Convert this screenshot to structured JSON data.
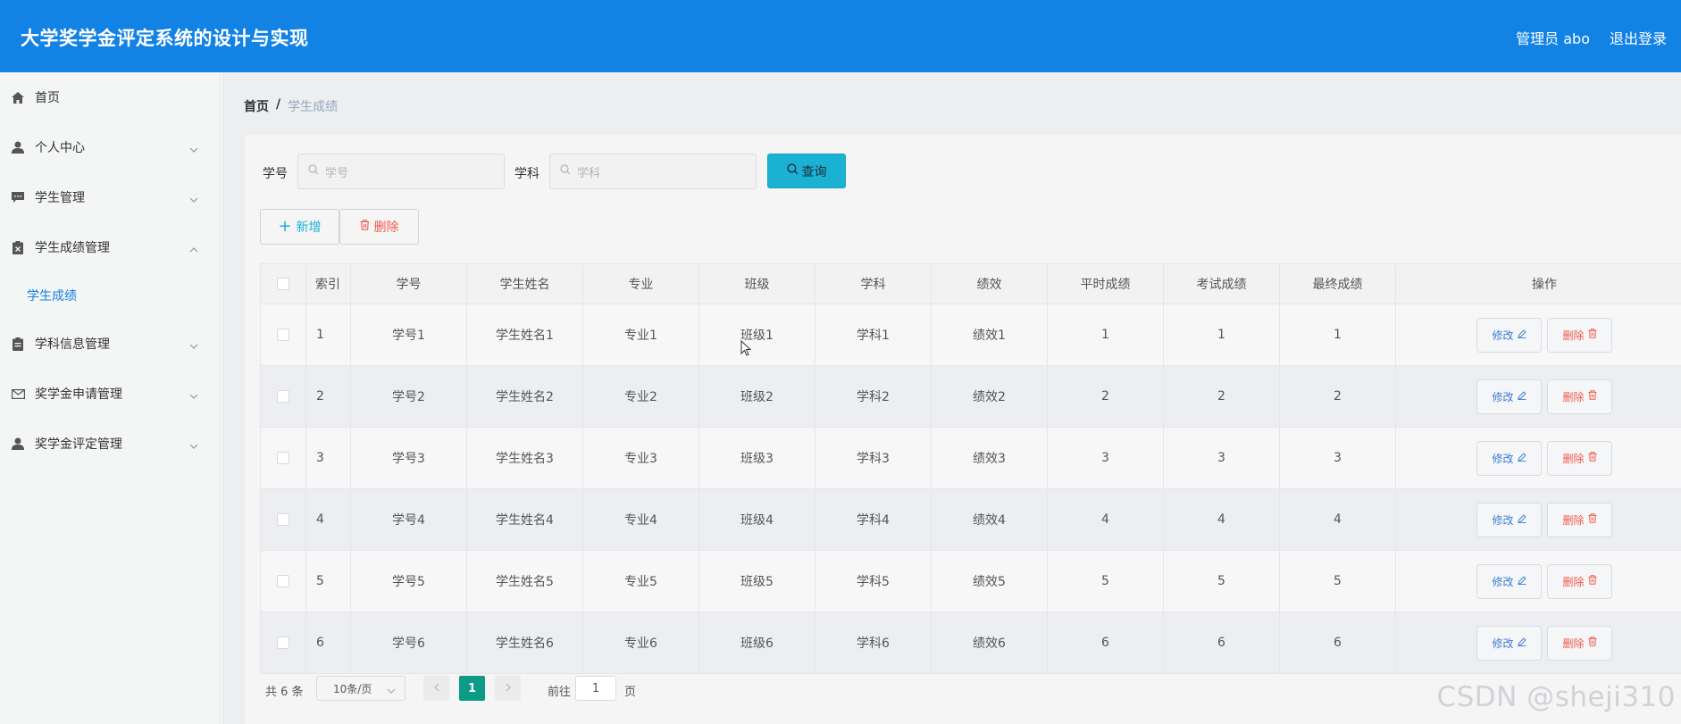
{
  "header": {
    "title": "大学奖学金评定系统的设计与实现",
    "user": "管理员 abo",
    "logout": "退出登录",
    "bg_color": "#1282e4"
  },
  "sidebar": {
    "items": [
      {
        "label": "首页",
        "icon": "home-icon"
      },
      {
        "label": "个人中心",
        "icon": "user-icon",
        "expandable": true
      },
      {
        "label": "学生管理",
        "icon": "message-icon",
        "expandable": true
      },
      {
        "label": "学生成绩管理",
        "icon": "clipboard-x-icon",
        "expanded": true
      },
      {
        "label": "学科信息管理",
        "icon": "clipboard-icon",
        "expandable": true
      },
      {
        "label": "奖学金申请管理",
        "icon": "mail-icon",
        "expandable": true
      },
      {
        "label": "奖学金评定管理",
        "icon": "user-icon",
        "expandable": true
      }
    ],
    "sub_item": "学生成绩"
  },
  "breadcrumb": {
    "home": "首页",
    "separator": "/",
    "current": "学生成绩"
  },
  "search": {
    "id_label": "学号",
    "id_placeholder": "学号",
    "subject_label": "学科",
    "subject_placeholder": "学科",
    "query_button": "查询"
  },
  "toolbar": {
    "add": "新增",
    "delete": "删除"
  },
  "table": {
    "headers": [
      "索引",
      "学号",
      "学生姓名",
      "专业",
      "班级",
      "学科",
      "绩效",
      "平时成绩",
      "考试成绩",
      "最终成绩",
      "操作"
    ],
    "rows": [
      {
        "idx": "1",
        "sid": "学号1",
        "name": "学生姓名1",
        "major": "专业1",
        "cls": "班级1",
        "subject": "学科1",
        "perf": "绩效1",
        "usual": "1",
        "exam": "1",
        "final": "1"
      },
      {
        "idx": "2",
        "sid": "学号2",
        "name": "学生姓名2",
        "major": "专业2",
        "cls": "班级2",
        "subject": "学科2",
        "perf": "绩效2",
        "usual": "2",
        "exam": "2",
        "final": "2"
      },
      {
        "idx": "3",
        "sid": "学号3",
        "name": "学生姓名3",
        "major": "专业3",
        "cls": "班级3",
        "subject": "学科3",
        "perf": "绩效3",
        "usual": "3",
        "exam": "3",
        "final": "3"
      },
      {
        "idx": "4",
        "sid": "学号4",
        "name": "学生姓名4",
        "major": "专业4",
        "cls": "班级4",
        "subject": "学科4",
        "perf": "绩效4",
        "usual": "4",
        "exam": "4",
        "final": "4"
      },
      {
        "idx": "5",
        "sid": "学号5",
        "name": "学生姓名5",
        "major": "专业5",
        "cls": "班级5",
        "subject": "学科5",
        "perf": "绩效5",
        "usual": "5",
        "exam": "5",
        "final": "5"
      },
      {
        "idx": "6",
        "sid": "学号6",
        "name": "学生姓名6",
        "major": "专业6",
        "cls": "班级6",
        "subject": "学科6",
        "perf": "绩效6",
        "usual": "6",
        "exam": "6",
        "final": "6"
      }
    ],
    "edit_label": "修改",
    "delete_label": "删除"
  },
  "pagination": {
    "total": "共 6 条",
    "page_size": "10条/页",
    "current_page": "1",
    "goto_label": "前往",
    "goto_value": "1",
    "page_unit": "页",
    "accent": "#0b9b86"
  },
  "watermark": "CSDN @sheji310"
}
